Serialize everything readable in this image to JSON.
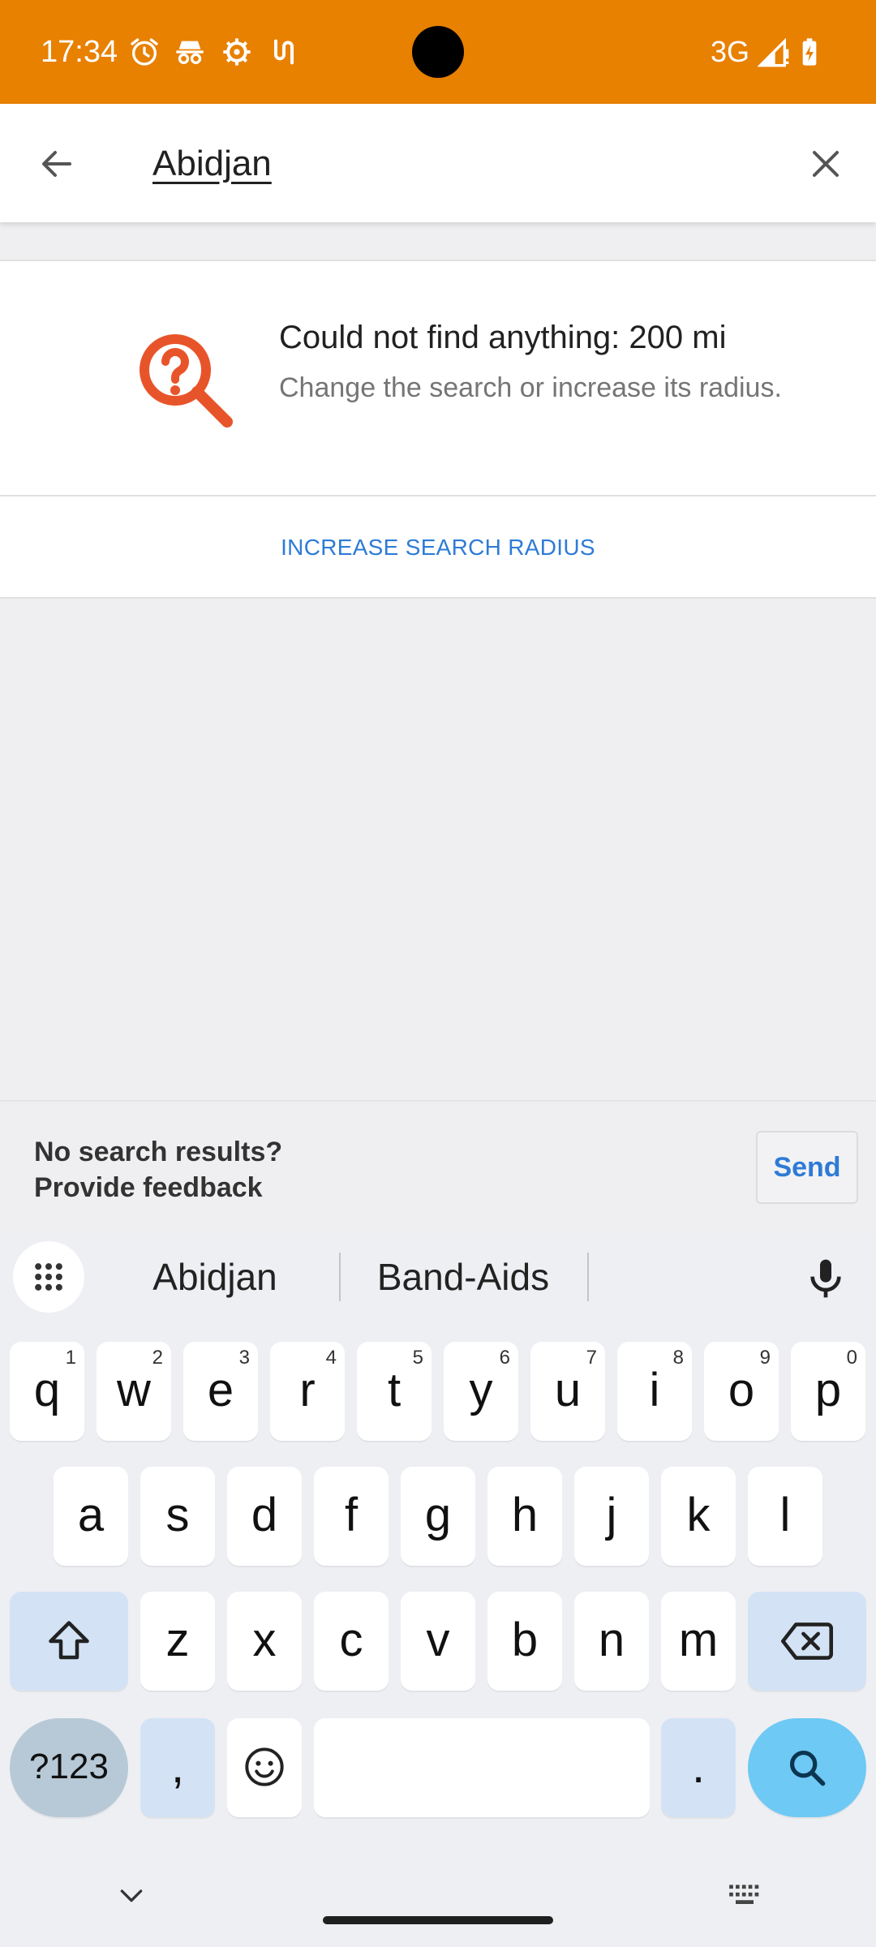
{
  "status_bar": {
    "time": "17:34",
    "network": "3G",
    "background_color": "#e88000",
    "icons": [
      "alarm-icon",
      "incognito-icon",
      "settings-gear-icon",
      "tape-icon",
      "signal-icon",
      "battery-charging-icon"
    ]
  },
  "search": {
    "query": "Abidjan",
    "back_icon": "arrow-back-icon",
    "clear_icon": "close-icon"
  },
  "empty_state": {
    "icon": "search-question-icon",
    "icon_color": "#e8542a",
    "title": "Could not find anything: 200 mi",
    "subtitle": "Change the search or increase its radius.",
    "action_label": "INCREASE SEARCH RADIUS",
    "action_color": "#2e7bd6"
  },
  "feedback": {
    "text": "No search results?\nProvide feedback",
    "send_label": "Send"
  },
  "keyboard": {
    "suggestions": [
      "Abidjan",
      "Band-Aids"
    ],
    "row1": [
      {
        "key": "q",
        "hint": "1"
      },
      {
        "key": "w",
        "hint": "2"
      },
      {
        "key": "e",
        "hint": "3"
      },
      {
        "key": "r",
        "hint": "4"
      },
      {
        "key": "t",
        "hint": "5"
      },
      {
        "key": "y",
        "hint": "6"
      },
      {
        "key": "u",
        "hint": "7"
      },
      {
        "key": "i",
        "hint": "8"
      },
      {
        "key": "o",
        "hint": "9"
      },
      {
        "key": "p",
        "hint": "0"
      }
    ],
    "row2": [
      "a",
      "s",
      "d",
      "f",
      "g",
      "h",
      "j",
      "k",
      "l"
    ],
    "row3": [
      "z",
      "x",
      "c",
      "v",
      "b",
      "n",
      "m"
    ],
    "symbols_label": "?123",
    "comma": ",",
    "period": ".",
    "icons": [
      "keyboard-grid-icon",
      "microphone-icon",
      "shift-icon",
      "backspace-icon",
      "emoji-icon",
      "search-icon",
      "chevron-down-icon",
      "keyboard-switch-icon"
    ]
  }
}
